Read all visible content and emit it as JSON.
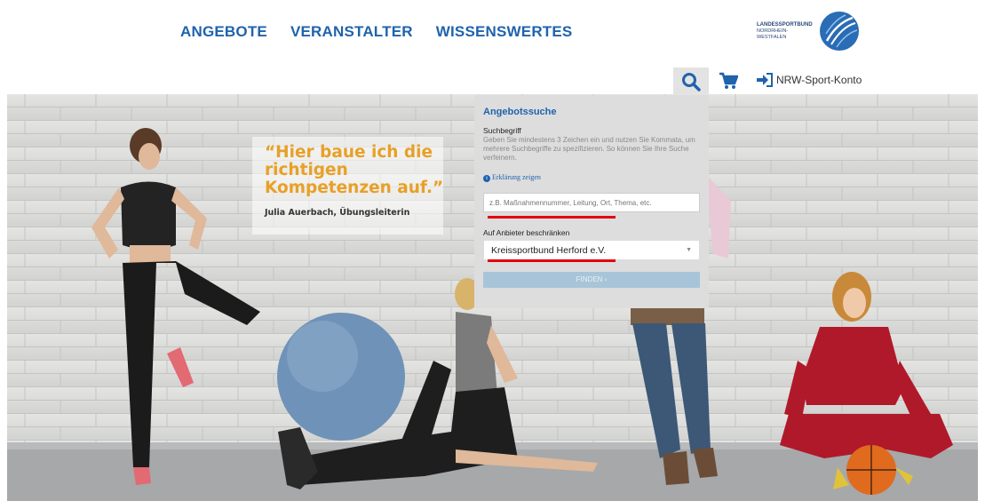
{
  "nav": {
    "items": [
      "ANGEBOTE",
      "VERANSTALTER",
      "WISSENSWERTES"
    ]
  },
  "logo": {
    "line1": "LANDESSPORTBUND",
    "line2": "NORDRHEIN-WESTFALEN"
  },
  "utility": {
    "search_icon": "search-icon",
    "cart_icon": "cart-icon",
    "account_icon": "login-arrow-icon",
    "account_label": "NRW-Sport-Konto"
  },
  "hero": {
    "quote": "“Hier baue ich die richtigen Kompetenzen auf.”",
    "author": "Julia Auerbach, Übungsleiterin"
  },
  "search_panel": {
    "title": "Angebotssuche",
    "term_label": "Suchbegriff",
    "help": "Geben Sie mindestens 3 Zeichen ein und nutzen Sie Kommata, um mehrere Suchbegriffe zu spezifizieren. So können Sie Ihre Suche verfeinern.",
    "explain_link": "Erklärung zeigen",
    "input_placeholder": "z.B. Maßnahmennummer, Leitung, Ort, Thema, etc.",
    "provider_label": "Auf Anbieter beschränken",
    "provider_selected": "Kreissportbund Herford e.V.",
    "find_button": "FINDEN ›"
  },
  "colors": {
    "brand_blue": "#1f63ad",
    "quote_orange": "#e8a027",
    "highlight_red": "#e3000f"
  }
}
